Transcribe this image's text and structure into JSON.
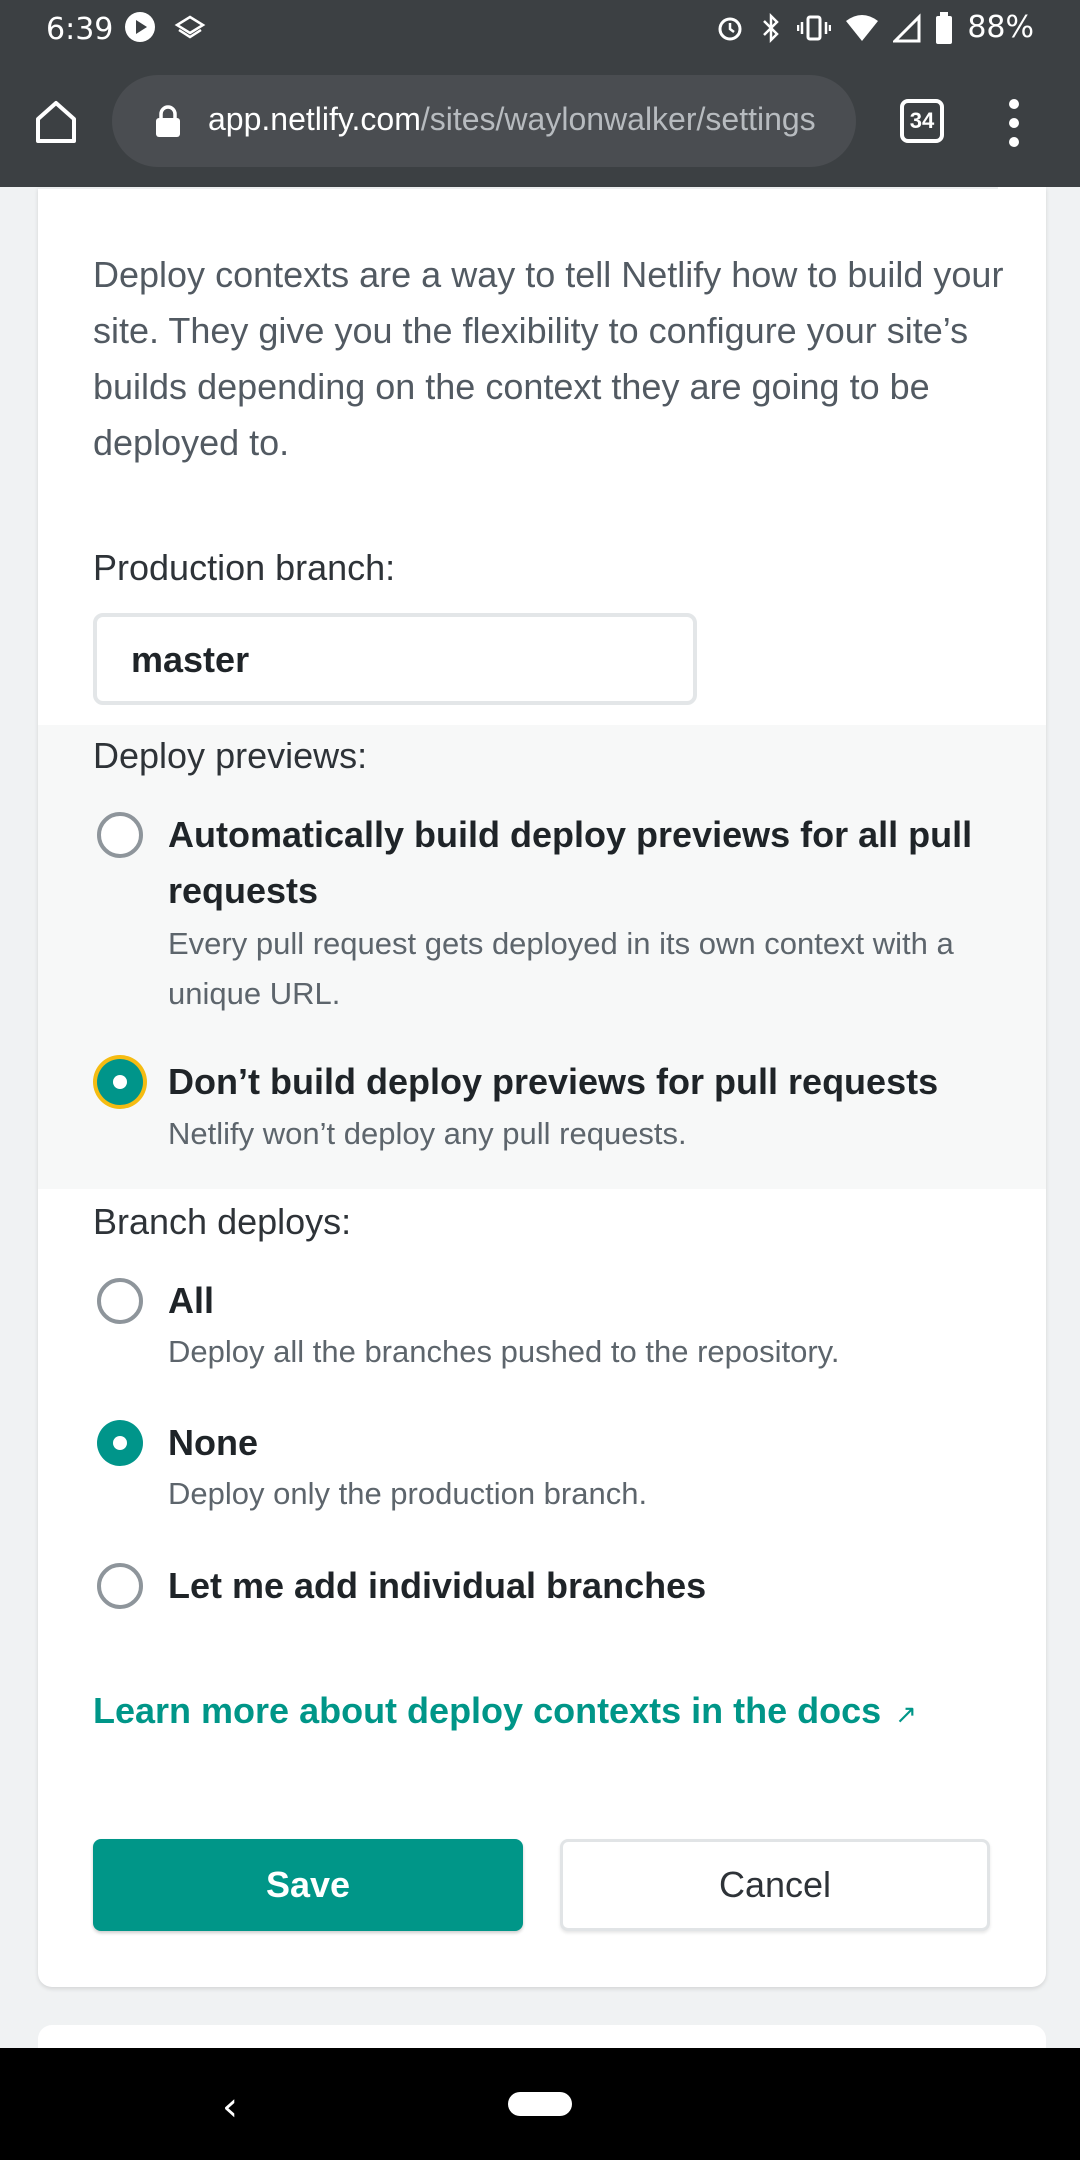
{
  "status_bar": {
    "time": "6:39",
    "battery": "88%",
    "icons": [
      "play-icon",
      "layers-icon",
      "alarm-icon",
      "bluetooth-icon",
      "vibrate-icon",
      "wifi-icon",
      "signal-icon",
      "battery-icon"
    ]
  },
  "browser": {
    "url_host": "app.netlify.com",
    "url_path": "/sites/waylonwalker/settings",
    "tab_count": "34"
  },
  "deploy_contexts": {
    "description": "Deploy contexts are a way to tell Netlify how to build your site. They give you the flexibility to configure your site’s builds depending on the context they are going to be deployed to.",
    "production_branch_label": "Production branch:",
    "production_branch_value": "master",
    "deploy_previews": {
      "label": "Deploy previews:",
      "options": [
        {
          "title": "Automatically build deploy previews for all pull requests",
          "description": "Every pull request gets deployed in its own context with a unique URL.",
          "selected": false
        },
        {
          "title": "Don’t build deploy previews for pull requests",
          "description": "Netlify won’t deploy any pull requests.",
          "selected": true
        }
      ]
    },
    "branch_deploys": {
      "label": "Branch deploys:",
      "options": [
        {
          "title": "All",
          "description": "Deploy all the branches pushed to the repository.",
          "selected": false
        },
        {
          "title": "None",
          "description": "Deploy only the production branch.",
          "selected": true
        },
        {
          "title": "Let me add individual branches",
          "description": "",
          "selected": false
        }
      ]
    },
    "docs_link": "Learn more about deploy contexts in the docs",
    "docs_link_arrow": "↗",
    "save_label": "Save",
    "cancel_label": "Cancel"
  },
  "colors": {
    "accent": "#009688",
    "focus_ring": "#f5bc12",
    "browser_chrome": "#3c4043"
  },
  "nav": {
    "back_glyph": "‹"
  }
}
